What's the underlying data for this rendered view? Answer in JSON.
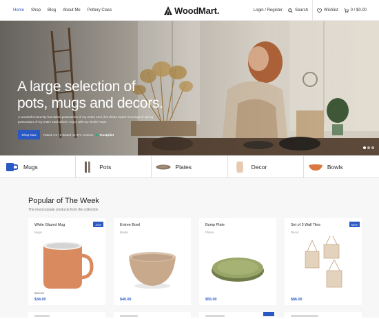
{
  "header": {
    "nav": [
      "Home",
      "Shop",
      "Blog",
      "About Me",
      "Pottery Class"
    ],
    "logo": "WoodMart.",
    "login": "Login / Register",
    "search": "Search",
    "wishlist": "Wishlist",
    "cart": "0 / $0.00"
  },
  "hero": {
    "title_line1": "A large selection of",
    "title_line2": "pots, mugs and decors.",
    "subtitle": "A wonderful serenity has taken possession of my entire soul, like these sweet mornings of spring possession of my entire soul which I enjoy with my whole heart.",
    "button": "Shop Now",
    "rating": "Rated 4.9 / 5 based on 374 reviews",
    "trustpilot": "Trustpilot"
  },
  "categories": [
    {
      "label": "Mugs",
      "icon": "mug-icon"
    },
    {
      "label": "Pots",
      "icon": "pot-icon"
    },
    {
      "label": "Plates",
      "icon": "plate-icon"
    },
    {
      "label": "Decor",
      "icon": "decor-icon"
    },
    {
      "label": "Bowls",
      "icon": "bowl-icon"
    }
  ],
  "popular": {
    "title": "Popular of The Week",
    "subtitle": "The most popular products from the collection",
    "products": [
      {
        "name": "White Glazed Mug",
        "category": "Mugs",
        "badge": "-20%",
        "old_price": "$40.00",
        "price": "$34.00"
      },
      {
        "name": "Entree Bowl",
        "category": "Bowls",
        "badge": "",
        "old_price": "",
        "price": "$40.00"
      },
      {
        "name": "Bump Plate",
        "category": "Plates",
        "badge": "",
        "old_price": "",
        "price": "$55.00"
      },
      {
        "name": "Set of 3 Wall Tiles",
        "category": "Decor",
        "badge": "NEW",
        "old_price": "",
        "price": "$86.00"
      }
    ]
  },
  "colors": {
    "accent": "#2b59c3"
  }
}
